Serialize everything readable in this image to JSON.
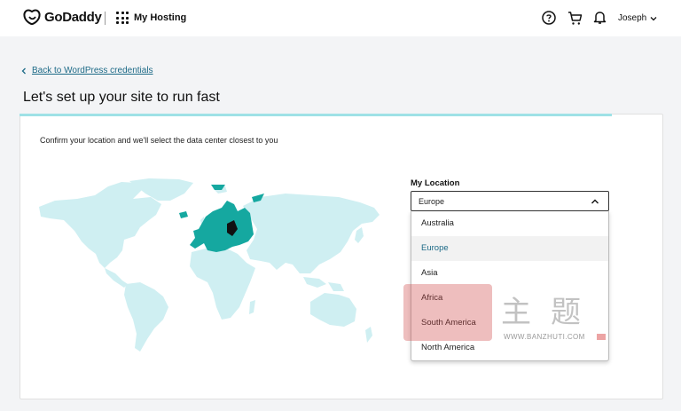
{
  "header": {
    "brand": "GoDaddy",
    "product": "My Hosting",
    "icons": [
      "godaddy-logo-icon",
      "apps-grid-icon",
      "help-icon",
      "cart-icon",
      "bell-icon",
      "chevron-down-icon"
    ],
    "user_name": "Joseph"
  },
  "nav": {
    "back_label": "Back to WordPress credentials"
  },
  "page": {
    "title": "Let's set up your site to run fast",
    "progress": 0.92
  },
  "content": {
    "instruction": "Confirm your location and we'll select the data center closest to you",
    "location_label": "My Location",
    "selected_location": "Europe",
    "options": [
      "Australia",
      "Europe",
      "Asia",
      "Africa",
      "South America",
      "North America"
    ]
  },
  "colors": {
    "accent": "#1d6a87",
    "map_land": "#cfeff2",
    "map_selected": "#15a8a0",
    "progress": "#9ee1e6"
  },
  "watermark": {
    "url": "WWW.BANZHUTI.COM",
    "chars": "主题"
  }
}
